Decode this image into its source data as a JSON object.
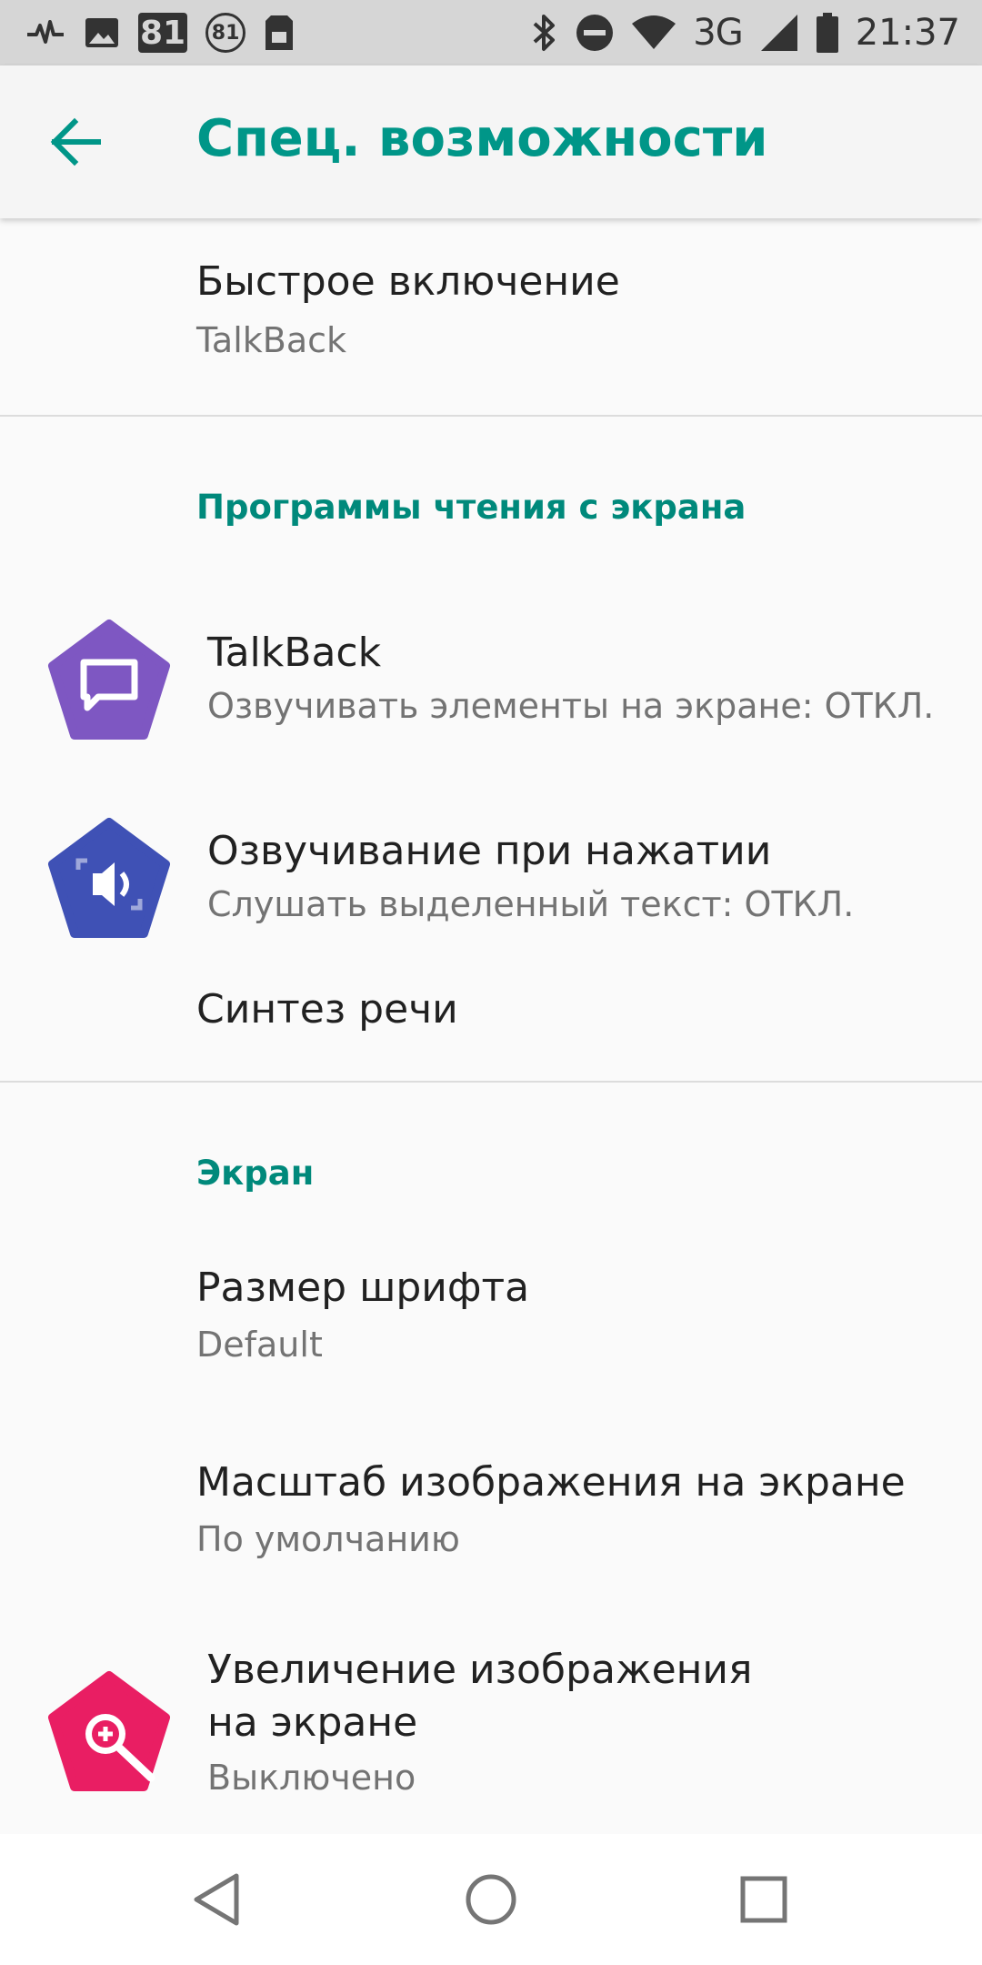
{
  "status_bar": {
    "left_icons": [
      "pulse-icon",
      "image-icon",
      "battery-level-icon",
      "battery-circle-icon",
      "sim-card-icon"
    ],
    "badge_81": "81",
    "circle_81": "81",
    "right_icons": [
      "bluetooth-icon",
      "do-not-disturb-icon",
      "wifi-icon",
      "cell-signal-icon",
      "battery-icon"
    ],
    "network": "3G",
    "time": "21:37"
  },
  "app_bar": {
    "title": "Спец. возможности"
  },
  "list": {
    "quick_enable": {
      "title": "Быстрое включение",
      "subtitle": "TalkBack"
    },
    "screen_readers_header": "Программы чтения с экрана",
    "talkback": {
      "title": "TalkBack",
      "subtitle": "Озвучивать элементы на экране: ОТКЛ."
    },
    "select_to_speak": {
      "title": "Озвучивание при нажатии",
      "subtitle": "Слушать выделенный текст: ОТКЛ."
    },
    "tts": {
      "title": "Синтез речи"
    },
    "screen_header": "Экран",
    "font_size": {
      "title": "Размер шрифта",
      "subtitle": "Default"
    },
    "display_size": {
      "title": "Масштаб изображения на экране",
      "subtitle": "По умолчанию"
    },
    "magnification": {
      "title_line1": "Увеличение изображения",
      "title_line2": "на экране",
      "subtitle": "Выключено"
    }
  },
  "colors": {
    "accent": "#009688",
    "talkback_icon": "#7e57c2",
    "select_to_speak_icon": "#3f51b5",
    "magnification_icon": "#e91e63"
  },
  "nav_bar": {
    "buttons": [
      "back-triangle-icon",
      "home-circle-icon",
      "recents-square-icon"
    ]
  }
}
